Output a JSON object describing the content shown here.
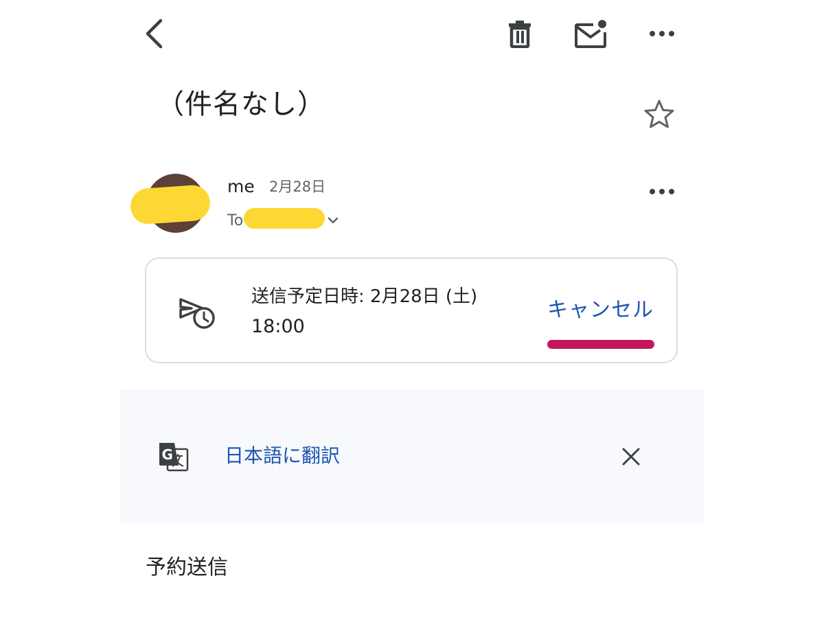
{
  "topbar": {
    "back_icon": "chevron-left-icon",
    "delete_icon": "trash-icon",
    "mark_unread_icon": "mail-unread-icon",
    "more_icon": "more-horizontal-icon"
  },
  "email": {
    "subject": "（件名なし）",
    "star_icon": "star-outline-icon",
    "sender": {
      "name": "me",
      "date": "2月28日",
      "to_label": "To",
      "details_icon": "chevron-down-icon",
      "more_icon": "more-horizontal-icon"
    },
    "schedule": {
      "icon": "scheduled-send-icon",
      "line1": "送信予定日時: 2月28日 (土)",
      "line2": "18:00",
      "cancel_label": "キャンセル",
      "accent_color": "#c2185b"
    },
    "translate": {
      "icon": "google-translate-icon",
      "link_label": "日本語に翻訳",
      "close_icon": "close-icon"
    },
    "body": "予約送信"
  },
  "colors": {
    "link": "#1a56b0",
    "avatar": "#5d4037",
    "redaction": "#fdd835"
  }
}
